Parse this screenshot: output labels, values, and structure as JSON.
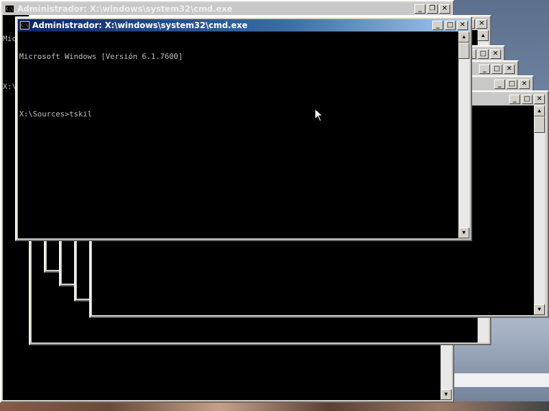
{
  "back_window": {
    "title": "Administrador: X:\\windows\\system32\\cmd.exe",
    "lines": [
      "Mic",
      "",
      "X:\\"
    ]
  },
  "front_window": {
    "title": "Administrador: X:\\windows\\system32\\cmd.exe",
    "lines": [
      "Microsoft Windows [Versión 6.1.7600]",
      "",
      "X:\\Sources>tskil"
    ]
  },
  "buttons": {
    "minimize": "_",
    "maximize": "□",
    "restore": "❐",
    "close": "✕"
  },
  "scroll": {
    "up": "▲",
    "down": "▼"
  },
  "colors": {
    "title_active": "#0a246a",
    "title_inactive": "#c8c8c8",
    "console_bg": "#000000",
    "console_fg": "#c0c0c0"
  }
}
